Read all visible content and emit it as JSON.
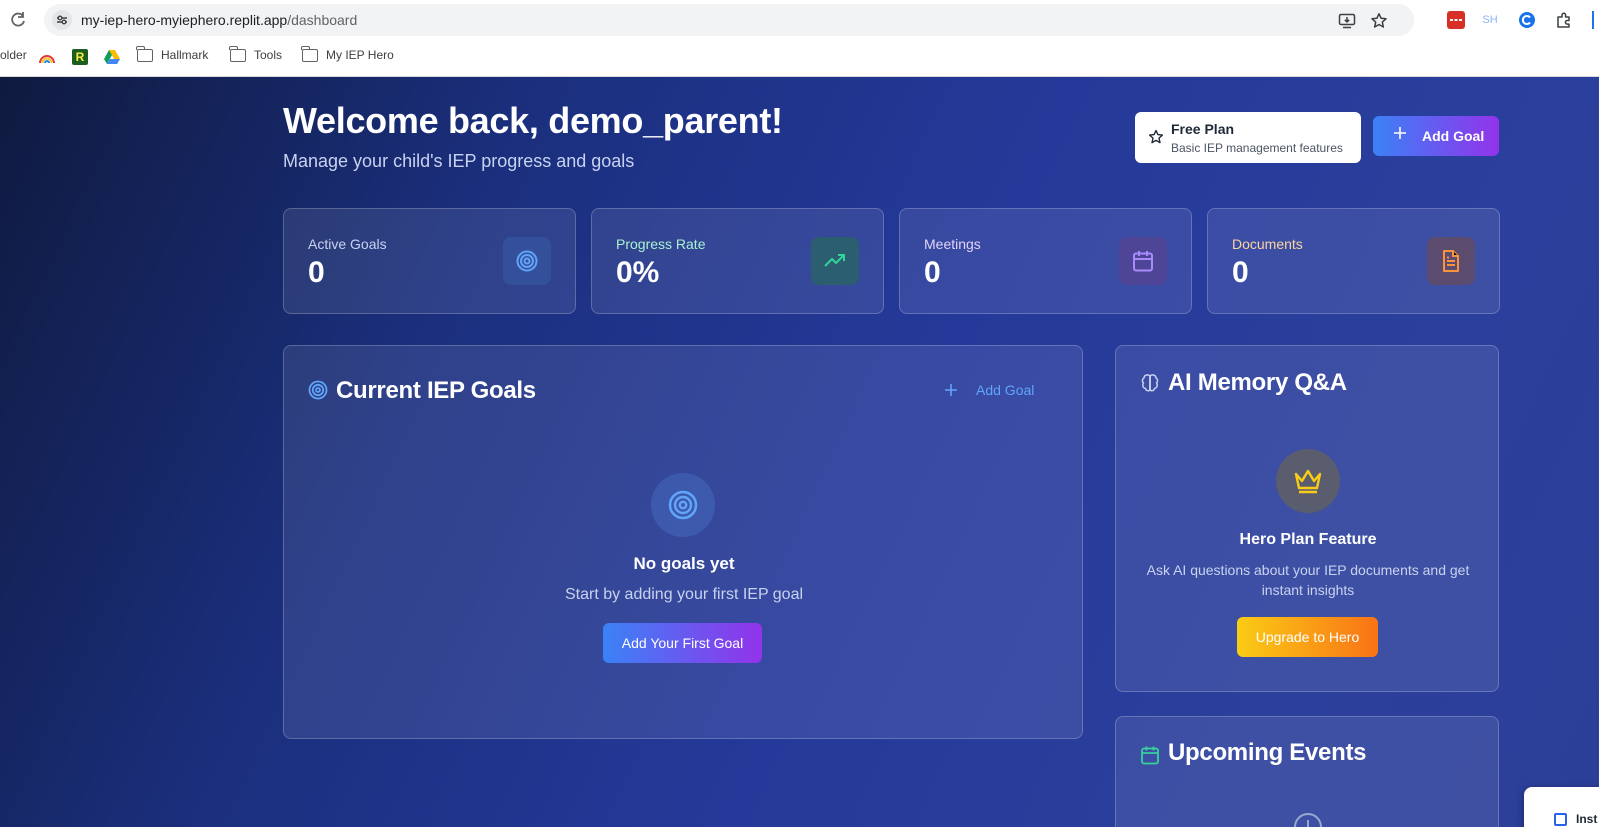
{
  "browser": {
    "url_host": "my-iep-hero-myiephero.replit.app",
    "url_path": "/dashboard",
    "profile_badge": "SH",
    "bookmarks": [
      {
        "label": "older"
      },
      {
        "label": "Hallmark"
      },
      {
        "label": "Tools"
      },
      {
        "label": "My IEP Hero"
      }
    ]
  },
  "header": {
    "welcome": "Welcome back, demo_parent!",
    "subtitle": "Manage your child's IEP progress and goals"
  },
  "plan": {
    "name": "Free Plan",
    "description": "Basic IEP management features"
  },
  "actions": {
    "add_goal_label": "Add Goal"
  },
  "stats": [
    {
      "label": "Active Goals",
      "value": "0",
      "icon": "target-icon",
      "label_color": "#c8d2f0",
      "icon_bg": "#34509a",
      "icon_color": "#60a5fa"
    },
    {
      "label": "Progress Rate",
      "value": "0%",
      "icon": "trending-up-icon",
      "label_color": "#a7f3d0",
      "icon_bg": "#2b5e6e",
      "icon_color": "#34d399"
    },
    {
      "label": "Meetings",
      "value": "0",
      "icon": "calendar-icon",
      "label_color": "#e0d4f7",
      "icon_bg": "#4f4596",
      "icon_color": "#a78bfa"
    },
    {
      "label": "Documents",
      "value": "0",
      "icon": "document-icon",
      "label_color": "#fbd4a0",
      "icon_bg": "#5c4c6f",
      "icon_color": "#fb923c"
    }
  ],
  "goals": {
    "title": "Current IEP Goals",
    "add_label": "Add Goal",
    "empty_title": "No goals yet",
    "empty_desc": "Start by adding your first IEP goal",
    "empty_button": "Add Your First Goal"
  },
  "ai": {
    "title": "AI Memory Q&A",
    "feature_title": "Hero Plan Feature",
    "feature_desc": "Ask AI questions about your IEP documents and get instant insights",
    "upgrade_label": "Upgrade to Hero"
  },
  "events": {
    "title": "Upcoming Events"
  },
  "popup": {
    "text": "Inst"
  },
  "colors": {
    "accent_blue": "#3b82f6",
    "accent_purple": "#9333ea",
    "upgrade_yellow": "#facc15",
    "upgrade_orange": "#f97316"
  }
}
